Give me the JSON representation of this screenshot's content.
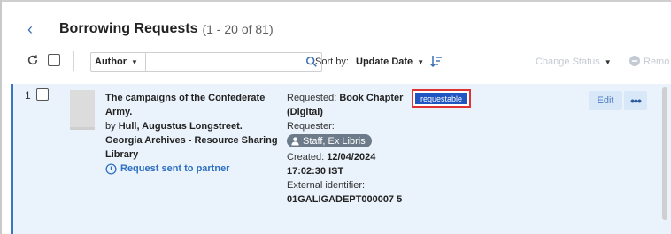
{
  "header": {
    "back_icon": "chevron-left-icon",
    "title": "Borrowing Requests",
    "range": "(1 - 20 of 81)"
  },
  "toolbar": {
    "refresh_icon": "refresh-icon",
    "search_field_label": "Author",
    "search_value": "",
    "search_icon": "search-icon",
    "sort_label": "Sort by:",
    "sort_value": "Update Date",
    "sort_direction_icon": "sort-descending-icon",
    "change_status": "Change Status",
    "remove_label": "Remo",
    "remove_icon": "minus-circle-icon",
    "disabled_color": "#c4cad3"
  },
  "results": [
    {
      "index": "1",
      "title": "The campaigns of the Confederate Army.",
      "by_label": "by",
      "author": "Hull, Augustus Longstreet.",
      "partner": "Georgia Archives - Resource Sharing Library",
      "status": "Request sent to partner",
      "status_icon": "clock-icon",
      "requested_label": "Requested:",
      "requested_value": "Book Chapter (Digital)",
      "requester_label": "Requester:",
      "requester": "Staff, Ex Libris",
      "created_label": "Created:",
      "created_value": "12/04/2024 17:02:30 IST",
      "external_id_label": "External identifier:",
      "external_id": "01GALIGADEPT000007 5",
      "badge": "requestable",
      "edit_label": "Edit",
      "more_label": "•••"
    }
  ],
  "colors": {
    "accent": "#3876c5",
    "row_bg": "#eaf2fb",
    "badge_bg": "#1f56c1",
    "highlight_border": "#dd3333",
    "chip_bg": "#6c7a89"
  }
}
